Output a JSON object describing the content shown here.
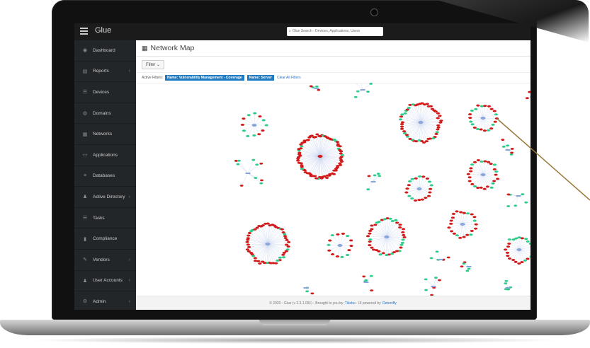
{
  "app": {
    "title": "Glue"
  },
  "search": {
    "placeholder": "Glue Search - Devices, Applications, Users"
  },
  "sidebar": {
    "items": [
      {
        "label": "Dashboard",
        "icon": "dashboard-icon",
        "glyph": "◉",
        "has_submenu": false
      },
      {
        "label": "Reports",
        "icon": "reports-icon",
        "glyph": "▤",
        "has_submenu": true
      },
      {
        "label": "Devices",
        "icon": "devices-icon",
        "glyph": "☰",
        "has_submenu": false
      },
      {
        "label": "Domains",
        "icon": "domains-icon",
        "glyph": "◍",
        "has_submenu": false
      },
      {
        "label": "Networks",
        "icon": "networks-icon",
        "glyph": "▦",
        "has_submenu": false
      },
      {
        "label": "Applications",
        "icon": "applications-icon",
        "glyph": "▭",
        "has_submenu": false
      },
      {
        "label": "Databases",
        "icon": "databases-icon",
        "glyph": "≡",
        "has_submenu": false
      },
      {
        "label": "Active Directory",
        "icon": "active-directory-icon",
        "glyph": "♟",
        "has_submenu": true
      },
      {
        "label": "Tasks",
        "icon": "tasks-icon",
        "glyph": "☰",
        "has_submenu": false
      },
      {
        "label": "Compliance",
        "icon": "compliance-icon",
        "glyph": "▮",
        "has_submenu": false
      },
      {
        "label": "Vendors",
        "icon": "vendors-icon",
        "glyph": "✎",
        "has_submenu": true
      },
      {
        "label": "User Accounts",
        "icon": "user-accounts-icon",
        "glyph": "♟",
        "has_submenu": true
      },
      {
        "label": "Admin",
        "icon": "admin-icon",
        "glyph": "⚙",
        "has_submenu": true
      }
    ]
  },
  "page": {
    "title": "Network Map"
  },
  "filter": {
    "label": "Filter ⌄"
  },
  "active_filters": {
    "label": "Active Filters:",
    "chips": [
      "Name: Vulnerability Management - Coverage",
      "Name: Server"
    ],
    "clear_label": "Clear All Filters"
  },
  "footer": {
    "prefix": "© 2020 - Glue (v 2.3.1.091) - Brought to you by",
    "link1": "Tikebu",
    "middle": ". UI powered by",
    "link2": "Reteniffy"
  },
  "colors": {
    "node_red": "#d11a1a",
    "node_green": "#2ecc8a",
    "node_blue": "#8aa6d8",
    "edge": "#b9c7ea",
    "accent": "#1f7bc1",
    "sidebar_bg": "#232629",
    "topbar_bg": "#1b1b1b",
    "pointer_line": "#9a7a3c"
  }
}
